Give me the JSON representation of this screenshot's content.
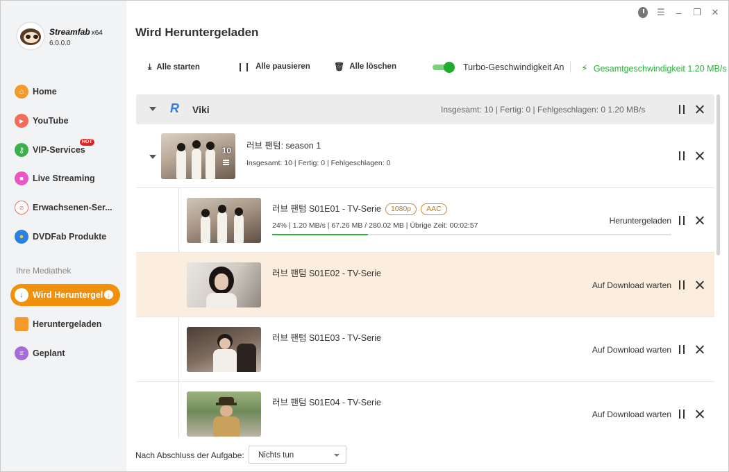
{
  "app": {
    "name": "Streamfab",
    "arch": "x64",
    "version": "6.0.0.0"
  },
  "sidebar": {
    "items": [
      {
        "label": "Home",
        "icon": "home-icon",
        "color": "#f39a2a"
      },
      {
        "label": "YouTube",
        "icon": "youtube-icon",
        "color": "#f26b5b"
      },
      {
        "label": "VIP-Services",
        "icon": "key-icon",
        "color": "#3cb04c",
        "badge": "HOT"
      },
      {
        "label": "Live Streaming",
        "icon": "camera-icon",
        "color": "#e957c6"
      },
      {
        "label": "Erwachsenen-Ser...",
        "icon": "no-18-icon",
        "color": "#f26b5b"
      },
      {
        "label": "DVDFab Produkte",
        "icon": "dvdfab-icon",
        "color": "#2a7fe0"
      }
    ],
    "library_label": "Ihre Mediathek",
    "library": [
      {
        "label": "Wird Heruntergel",
        "icon": "download-icon",
        "active": true
      },
      {
        "label": "Heruntergeladen",
        "icon": "folder-icon",
        "color": "#f39a2a"
      },
      {
        "label": "Geplant",
        "icon": "calendar-icon",
        "color": "#a66bd8"
      }
    ]
  },
  "page": {
    "title": "Wird Heruntergeladen"
  },
  "toolbar": {
    "start_all": "Alle starten",
    "pause_all": "Alle pausieren",
    "delete_all": "Alle löschen",
    "turbo_label": "Turbo-Geschwindigkeit An",
    "turbo_on": true,
    "total_speed": "Gesamtgeschwindigkeit 1.20 MB/s"
  },
  "group": {
    "name": "Viki",
    "logo_letter": "R",
    "stats": "Insgesamt: 10  | Fertig: 0  | Fehlgeschlagen: 0     1.20 MB/s"
  },
  "season": {
    "title": "러브 팬텀: season 1",
    "count": "10",
    "stats": "Insgesamt:  10  |  Fertig:  0  |  Fehlgeschlagen:  0"
  },
  "episodes": [
    {
      "title": "러브 팬텀 S01E01 - TV-Serie",
      "tags": [
        "1080p",
        "AAC"
      ],
      "stats": "24%  |  1.20 MB/s  |  67.26 MB / 280.02 MB  |  Übrige Zeit: 00:02:57",
      "progress": 0.24,
      "status": "Heruntergeladen"
    },
    {
      "title": "러브 팬텀 S01E02 - TV-Serie",
      "tags": [],
      "stats": "",
      "status": "Auf Download warten"
    },
    {
      "title": "러브 팬텀 S01E03 - TV-Serie",
      "tags": [],
      "stats": "",
      "status": "Auf Download warten"
    },
    {
      "title": "러브 팬텀 S01E04 - TV-Serie",
      "tags": [],
      "stats": "",
      "status": "Auf Download warten"
    }
  ],
  "footer": {
    "label": "Nach Abschluss der Aufgabe:",
    "select_value": "Nichts tun"
  },
  "colors": {
    "accent": "#f0900c",
    "green": "#2cb03a",
    "highlight_row": "#fbeede"
  }
}
